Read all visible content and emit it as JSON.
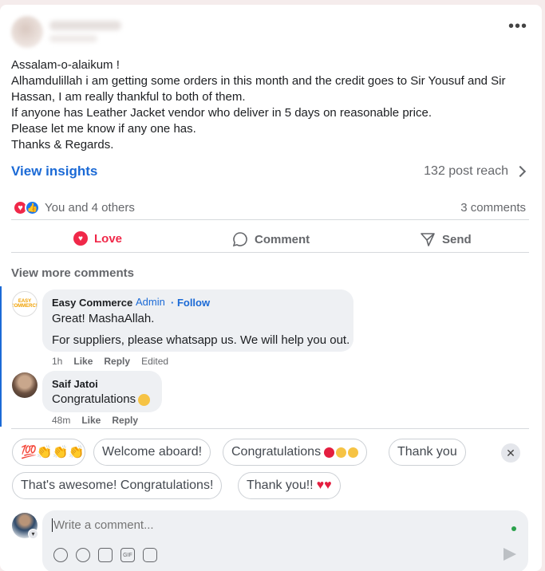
{
  "post": {
    "lines": [
      "Assalam-o-alaikum !",
      "Alhamdulillah i am getting some orders in this month and the credit goes to Sir Yousuf and Sir Hassan, I am really thankful to both of them.",
      "If anyone has Leather Jacket vendor who deliver in 5 days on reasonable price.",
      "Please let me know if any one has.",
      "Thanks & Regards."
    ],
    "insights_label": "View insights",
    "reach": "132 post reach"
  },
  "reactions": {
    "summary": "You and 4 others",
    "comments_count": "3 comments"
  },
  "actions": {
    "love": "Love",
    "comment": "Comment",
    "send": "Send"
  },
  "view_more_comments": "View more comments",
  "comments": [
    {
      "name": "Easy Commerce",
      "badge": "Admin",
      "follow": "· Follow",
      "lines": [
        "Great! MashaAllah.",
        "For suppliers, please whatsapp us. We will help you out."
      ],
      "time": "1h",
      "like": "Like",
      "reply": "Reply",
      "edited": "Edited",
      "avatar_text": "EASY COMMERCE"
    },
    {
      "name": "Saif Jatoi",
      "text": "Congratulations",
      "time": "48m",
      "like": "Like",
      "reply": "Reply"
    }
  ],
  "suggestions": [
    "💯👏👏👏",
    "Welcome aboard!",
    "Congratulations",
    "Thank you",
    "That's awesome! Congratulations!",
    "Thank you!!"
  ],
  "composer": {
    "placeholder": "Write a comment..."
  },
  "colors": {
    "accent": "#1b6ad6",
    "love": "#f02849",
    "background": "#f5ecec"
  }
}
